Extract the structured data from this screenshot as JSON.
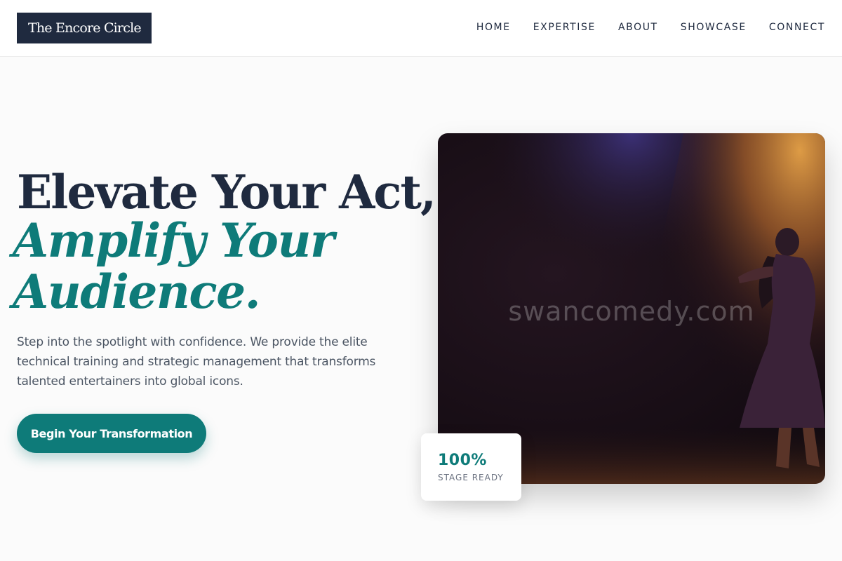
{
  "brand": {
    "name": "The Encore Circle"
  },
  "nav": {
    "items": [
      {
        "label": "HOME"
      },
      {
        "label": "EXPERTISE"
      },
      {
        "label": "ABOUT"
      },
      {
        "label": "SHOWCASE"
      },
      {
        "label": "CONNECT"
      }
    ]
  },
  "hero": {
    "headline": "Elevate Your Act,",
    "headline_accent": "Amplify Your Audience.",
    "subtitle": "Step into the spotlight with confidence. We provide the elite technical training and strategic management that transforms talented entertainers into global icons.",
    "cta_label": "Begin Your Transformation",
    "image_watermark": "swancomedy.com"
  },
  "stat": {
    "value": "100%",
    "label": "STAGE READY"
  },
  "colors": {
    "navy": "#1f2a3f",
    "teal": "#0e7b79",
    "text_muted": "#4b5563"
  },
  "icons": [
    "performer-silhouette"
  ]
}
